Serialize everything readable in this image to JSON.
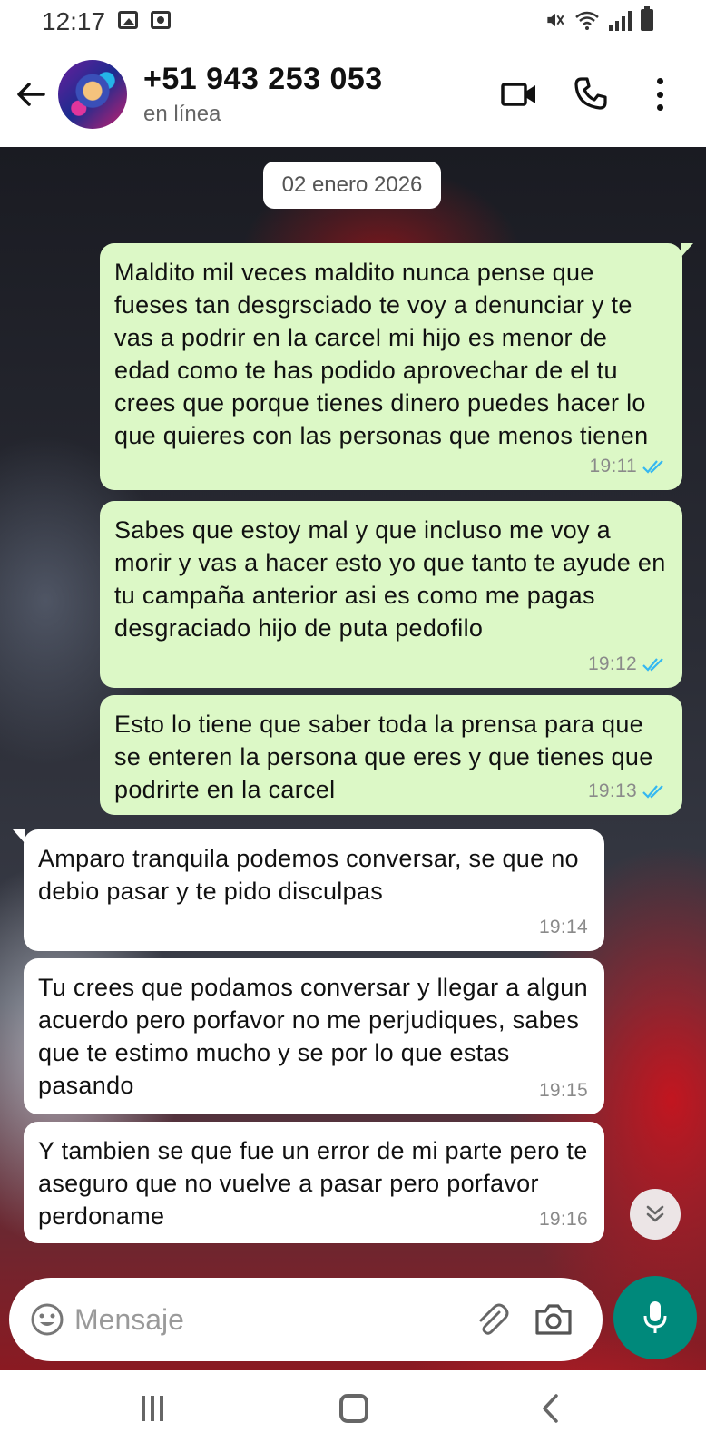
{
  "status_bar": {
    "time": "12:17",
    "mute_icon": "§"
  },
  "header": {
    "contact_name": "+51 943 253 053",
    "contact_status": "en línea"
  },
  "chat": {
    "date_chip": "02 enero 2026",
    "messages": [
      {
        "direction": "outgoing",
        "text": "Maldito mil veces maldito nunca pense que fueses tan desgrsciado te voy a denunciar y te vas a podrir en la carcel mi hijo es menor de edad como te has podido aprovechar de el tu crees que porque tienes dinero puedes hacer lo que quieres con las personas que menos tienen",
        "time": "19:11",
        "status": "read"
      },
      {
        "direction": "outgoing",
        "text": "Sabes que estoy mal y que incluso me voy a morir y vas a hacer esto yo que tanto te ayude en tu campaña anterior asi es como me pagas desgraciado hijo de puta pedofilo",
        "time": "19:12",
        "status": "read"
      },
      {
        "direction": "outgoing",
        "text": "Esto lo tiene que saber toda la prensa para que se enteren la persona que eres y que tienes que podrirte en la carcel",
        "time": "19:13",
        "status": "read"
      },
      {
        "direction": "incoming",
        "text": "Amparo tranquila podemos conversar, se que no debio pasar y te pido disculpas",
        "time": "19:14"
      },
      {
        "direction": "incoming",
        "text": "Tu crees que podamos conversar y llegar a algun acuerdo pero porfavor no me perjudiques, sabes que te estimo mucho y se por lo que estas pasando",
        "time": "19:15"
      },
      {
        "direction": "incoming",
        "text": "Y tambien se que fue un error de mi parte pero te aseguro que no vuelve a pasar pero porfavor perdoname",
        "time": "19:16"
      }
    ]
  },
  "composer": {
    "placeholder": "Mensaje",
    "value": ""
  },
  "colors": {
    "outgoing_bubble": "#dcf8c6",
    "incoming_bubble": "#ffffff",
    "mic_button": "#00897b",
    "read_ticks": "#34b7f1"
  },
  "icons": [
    "back-arrow-icon",
    "video-call-icon",
    "phone-icon",
    "more-vert-icon",
    "emoji-icon",
    "attach-icon",
    "camera-icon",
    "mic-icon",
    "scroll-down-icon",
    "recents-icon",
    "home-icon",
    "nav-back-icon"
  ]
}
